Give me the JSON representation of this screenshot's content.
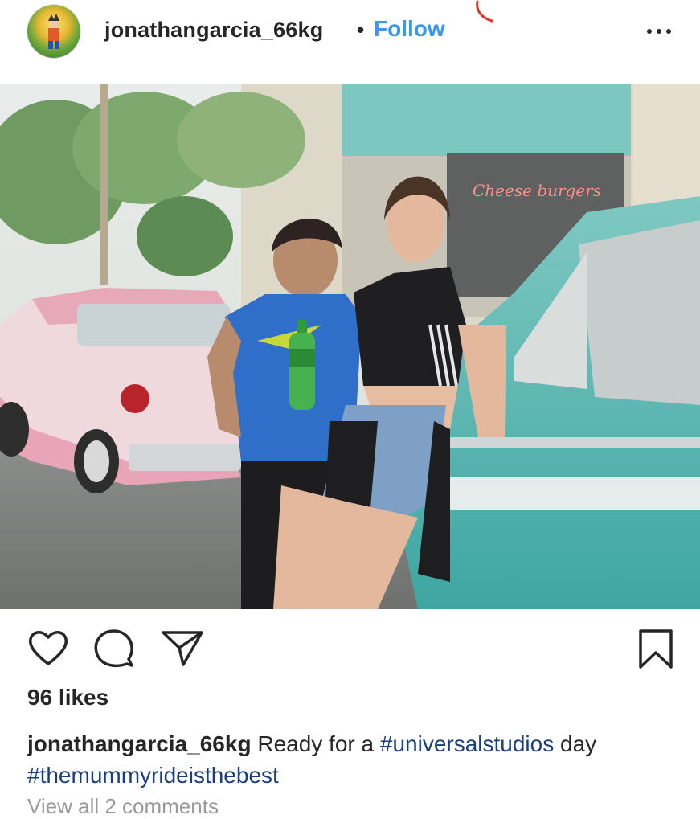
{
  "header": {
    "username": "jonathangarcia_66kg",
    "separator": "•",
    "follow_label": "Follow",
    "more_icon": "more-horizontal-icon"
  },
  "photo": {
    "neon_sign_text": "Cheese burgers"
  },
  "actions": {
    "like_icon": "heart-icon",
    "comment_icon": "comment-icon",
    "share_icon": "paper-plane-icon",
    "save_icon": "bookmark-icon"
  },
  "likes": "96 likes",
  "caption": {
    "username": "jonathangarcia_66kg",
    "text_1": " Ready for a ",
    "tag_1": "#universalstudios",
    "text_2": " day ",
    "tag_2": "#themummyrideisthebest"
  },
  "view_comments": "View all 2 comments",
  "colors": {
    "follow_blue": "#3897f0",
    "hashtag_blue": "#1c3f7a",
    "text_dark": "#262626"
  }
}
